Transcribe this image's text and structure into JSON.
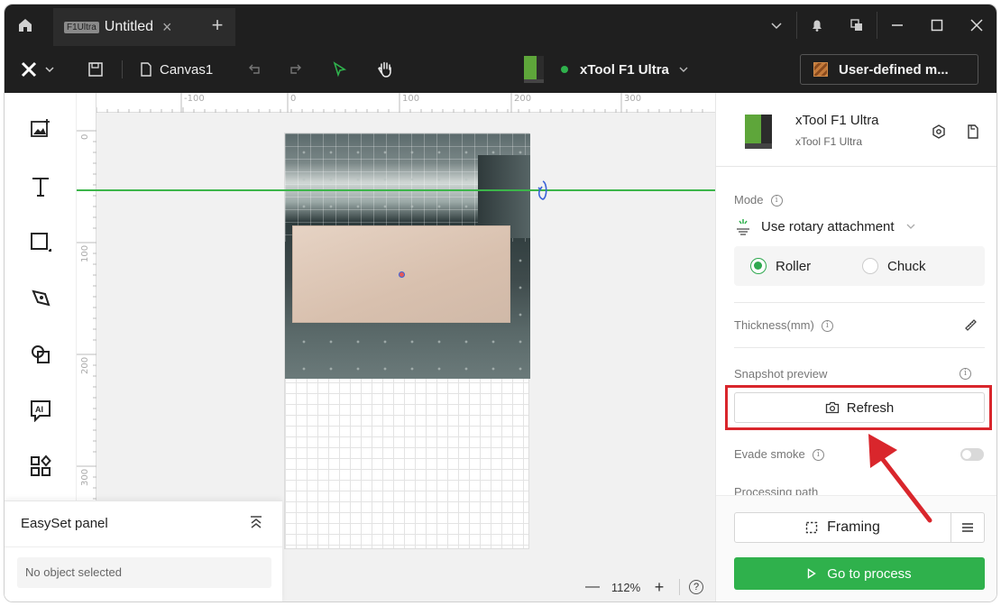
{
  "titlebar": {
    "tab_badge": "F1Ultra",
    "tab_title": "Untitled",
    "tab_close": "×",
    "tab_add": "+"
  },
  "toolbar": {
    "canvas_label": "Canvas1",
    "device_name": "xTool F1 Ultra",
    "device_status_color": "#2fb14c",
    "material_label": "User-defined m..."
  },
  "canvas": {
    "ruler_top": [
      "-100",
      "0",
      "100",
      "200",
      "300"
    ],
    "ruler_left": [
      "0",
      "100",
      "200",
      "300"
    ],
    "guide_color": "#3cb54a"
  },
  "easyset": {
    "title": "EasySet panel",
    "empty_text": "No object selected"
  },
  "zoom": {
    "minus": "—",
    "value": "112%",
    "plus": "+",
    "help": "?"
  },
  "rightpanel": {
    "device_name": "xTool F1 Ultra",
    "device_sub": "xTool F1 Ultra",
    "mode_label": "Mode",
    "mode_value": "Use rotary attachment",
    "roller_label": "Roller",
    "chuck_label": "Chuck",
    "roller_selected": true,
    "thickness_label": "Thickness(mm)",
    "snapshot_label": "Snapshot preview",
    "refresh_label": "Refresh",
    "evade_smoke_label": "Evade smoke",
    "evade_smoke_on": false,
    "processing_path_label": "Processing path",
    "framing_label": "Framing",
    "process_label": "Go to process",
    "accent_color": "#2fb14c"
  },
  "annotation": {
    "highlight_color": "#d9262c"
  }
}
